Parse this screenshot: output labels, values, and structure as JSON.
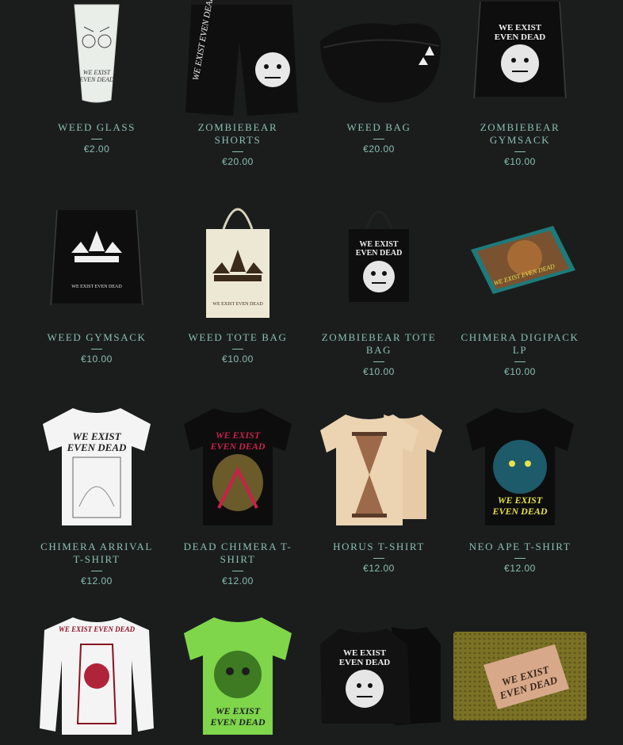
{
  "products": [
    {
      "title": "WEED GLASS",
      "price": "€2.00",
      "icon": "glass-icon"
    },
    {
      "title": "ZOMBIEBEAR SHORTS",
      "price": "€20.00",
      "icon": "shorts-icon"
    },
    {
      "title": "WEED BAG",
      "price": "€20.00",
      "icon": "bag-icon"
    },
    {
      "title": "ZOMBIEBEAR GYMSACK",
      "price": "€10.00",
      "icon": "gymsack-icon"
    },
    {
      "title": "WEED GYMSACK",
      "price": "€10.00",
      "icon": "gymsack-icon"
    },
    {
      "title": "WEED TOTE BAG",
      "price": "€10.00",
      "icon": "tote-bag-icon"
    },
    {
      "title": "ZOMBIEBEAR TOTE BAG",
      "price": "€10.00",
      "icon": "tote-bag-icon"
    },
    {
      "title": "CHIMERA DIGIPACK LP",
      "price": "€10.00",
      "icon": "cd-icon"
    },
    {
      "title": "CHIMERA ARRIVAL T-SHIRT",
      "price": "€12.00",
      "icon": "tshirt-icon"
    },
    {
      "title": "DEAD CHIMERA T-SHIRT",
      "price": "€12.00",
      "icon": "tshirt-icon"
    },
    {
      "title": "HORUS T-SHIRT",
      "price": "€12.00",
      "icon": "tshirt-icon"
    },
    {
      "title": "NEO APE T-SHIRT",
      "price": "€12.00",
      "icon": "tshirt-icon"
    },
    {
      "title": "",
      "price": "",
      "icon": "longsleeve-icon"
    },
    {
      "title": "",
      "price": "",
      "icon": "tshirt-icon"
    },
    {
      "title": "",
      "price": "",
      "icon": "jacket-icon"
    },
    {
      "title": "",
      "price": "",
      "icon": "patch-icon"
    }
  ],
  "print_text": {
    "logo": "WE EXIST EVEN DEAD",
    "logo_short": "WE EXIST",
    "logo_short2": "EVEN DEAD"
  },
  "colors": {
    "background": "#1b1d1d",
    "accent": "#8cbfb2",
    "shirt_black": "#0d0d0d",
    "shirt_white": "#f4f4f4",
    "shirt_sand": "#ecd3b1",
    "shirt_green": "#7fd64b",
    "print_red": "#c8214a",
    "print_yellow": "#e6e34a",
    "tote_cream": "#ede8d4"
  }
}
